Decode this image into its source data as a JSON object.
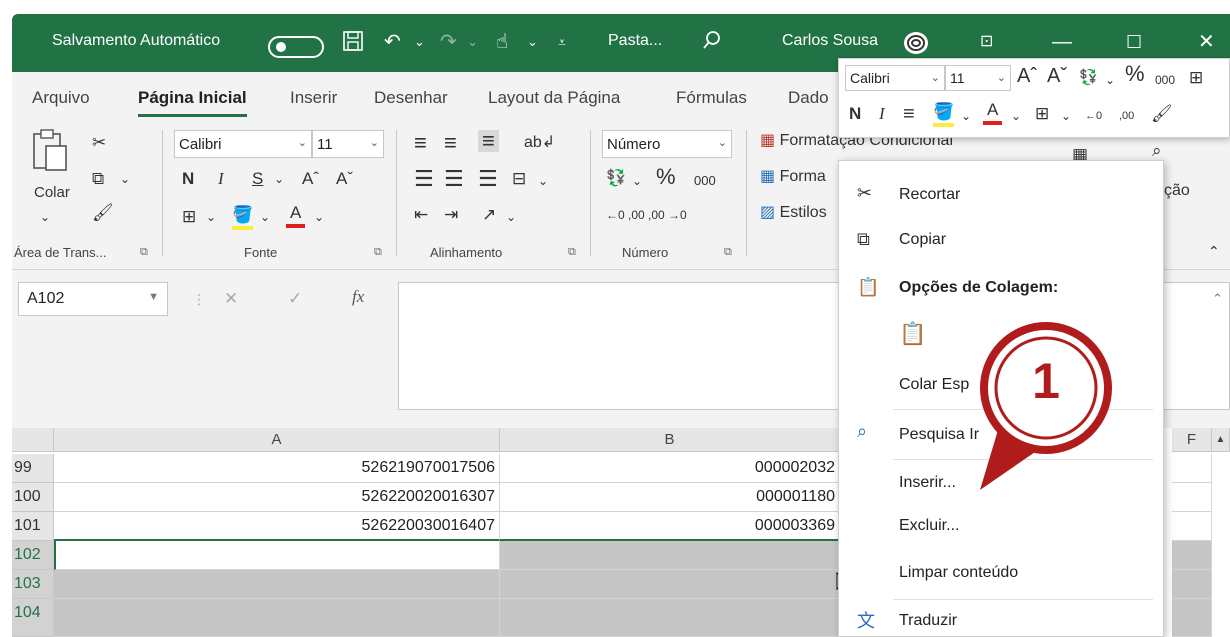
{
  "titlebar": {
    "autosave_label": "Salvamento Automático",
    "doc_name": "Pasta...",
    "user_name": "Carlos Sousa",
    "save_icon": "save-icon",
    "undo_icon": "undo-icon",
    "redo_icon": "redo-icon",
    "touch_icon": "touch-mode-icon",
    "search_icon": "search-icon"
  },
  "tabs": [
    "Arquivo",
    "Página Inicial",
    "Inserir",
    "Desenhar",
    "Layout da Página",
    "Fórmulas",
    "Dado"
  ],
  "ribbon": {
    "paste_label": "Colar",
    "font_name": "Calibri",
    "font_size": "11",
    "bold": "N",
    "italic": "I",
    "underline": "S",
    "grow_font": "Aˆ",
    "shrink_font": "Aˇ",
    "font_color_letter": "A",
    "number_format": "Número",
    "percent": "%",
    "thousands": "000",
    "decimal_inc": "←0 ,00",
    "decimal_dec": ",00 →0",
    "cond_format": "Formatação Condicional",
    "format_table": "Forma",
    "cell_styles": "Estilos",
    "cao": "ção",
    "groups": {
      "clipboard": "Área de Trans...",
      "font": "Fonte",
      "alignment": "Alinhamento",
      "number": "Número"
    }
  },
  "formula_bar": {
    "name_box": "A102",
    "fx": "fx"
  },
  "grid": {
    "columns": [
      "A",
      "B",
      "F"
    ],
    "rows": [
      {
        "num": "99",
        "a": "526219070017506",
        "b": "000002032"
      },
      {
        "num": "100",
        "a": "526220020016307",
        "b": "000001180"
      },
      {
        "num": "101",
        "a": "526220030016407",
        "b": "000003369"
      },
      {
        "num": "102",
        "a": "",
        "b": ""
      },
      {
        "num": "103",
        "a": "",
        "b": ""
      },
      {
        "num": "104",
        "a": "",
        "b": ""
      }
    ]
  },
  "mini_toolbar": {
    "font_name": "Calibri",
    "font_size": "11",
    "grow": "Aˆ",
    "shrink": "Aˇ",
    "percent": "%",
    "thousands": "000",
    "bold": "N",
    "italic": "I",
    "font_color": "A",
    "dec_inc": "←0",
    "dec_dec": ",00"
  },
  "context_menu": {
    "items": [
      {
        "label": "Recortar",
        "icon": "scissors-icon"
      },
      {
        "label": "Copiar",
        "icon": "copy-icon"
      },
      {
        "label": "Opções de Colagem:",
        "icon": "paste-options-icon"
      },
      {
        "label": "Colar Esp",
        "icon": ""
      },
      {
        "label": "Pesquisa Ir",
        "icon": "smart-lookup-icon"
      },
      {
        "label": "Inserir...",
        "icon": ""
      },
      {
        "label": "Excluir...",
        "icon": ""
      },
      {
        "label": "Limpar conteúdo",
        "icon": ""
      },
      {
        "label": "Traduzir",
        "icon": "translate-icon"
      }
    ]
  },
  "annotation": {
    "number": "1",
    "color": "#b01c1c"
  },
  "colors": {
    "accent": "#217346",
    "ribbon_bg": "#f3f3f3",
    "selection_grey": "#c6c6c6"
  }
}
